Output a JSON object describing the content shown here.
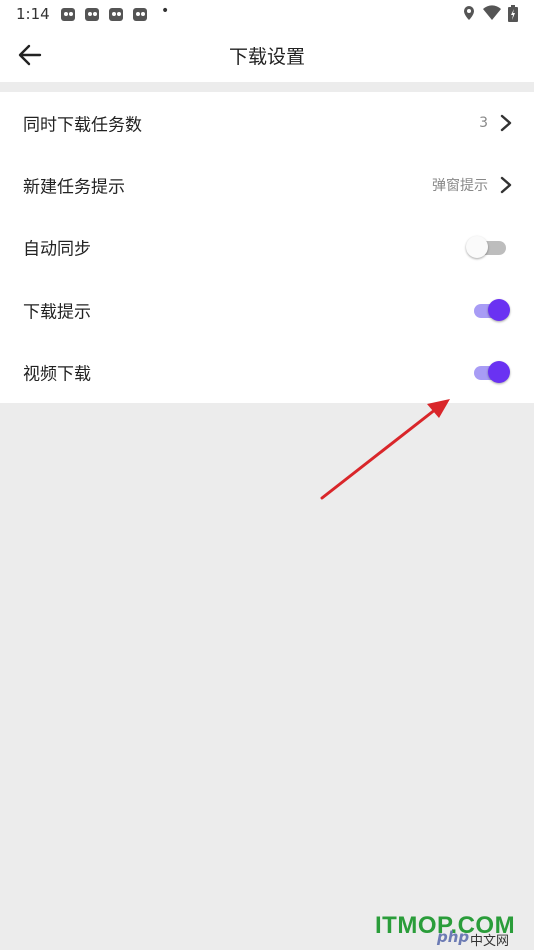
{
  "status_bar": {
    "time": "1:14",
    "notification_icons": [
      "app-notification-icon",
      "app-notification-icon",
      "app-notification-icon",
      "app-notification-icon"
    ],
    "dot": "•",
    "system_icons": [
      "location-icon",
      "wifi-icon",
      "battery-charging-icon"
    ]
  },
  "header": {
    "title": "下载设置",
    "back_icon": "arrow-left-icon"
  },
  "settings": {
    "items": [
      {
        "label": "同时下载任务数",
        "value": "3",
        "control": "chevron"
      },
      {
        "label": "新建任务提示",
        "value": "弹窗提示",
        "control": "chevron"
      },
      {
        "label": "自动同步",
        "control": "toggle",
        "on": false
      },
      {
        "label": "下载提示",
        "control": "toggle",
        "on": true
      },
      {
        "label": "视频下载",
        "control": "toggle",
        "on": true
      }
    ]
  },
  "colors": {
    "accent": "#6a32f2",
    "accent_track": "#a89cf5",
    "annotation_arrow": "#d9262a",
    "background": "#ececec"
  },
  "watermark": {
    "php": "php",
    "cn": "中文网",
    "site": "ITMOP.COM"
  }
}
